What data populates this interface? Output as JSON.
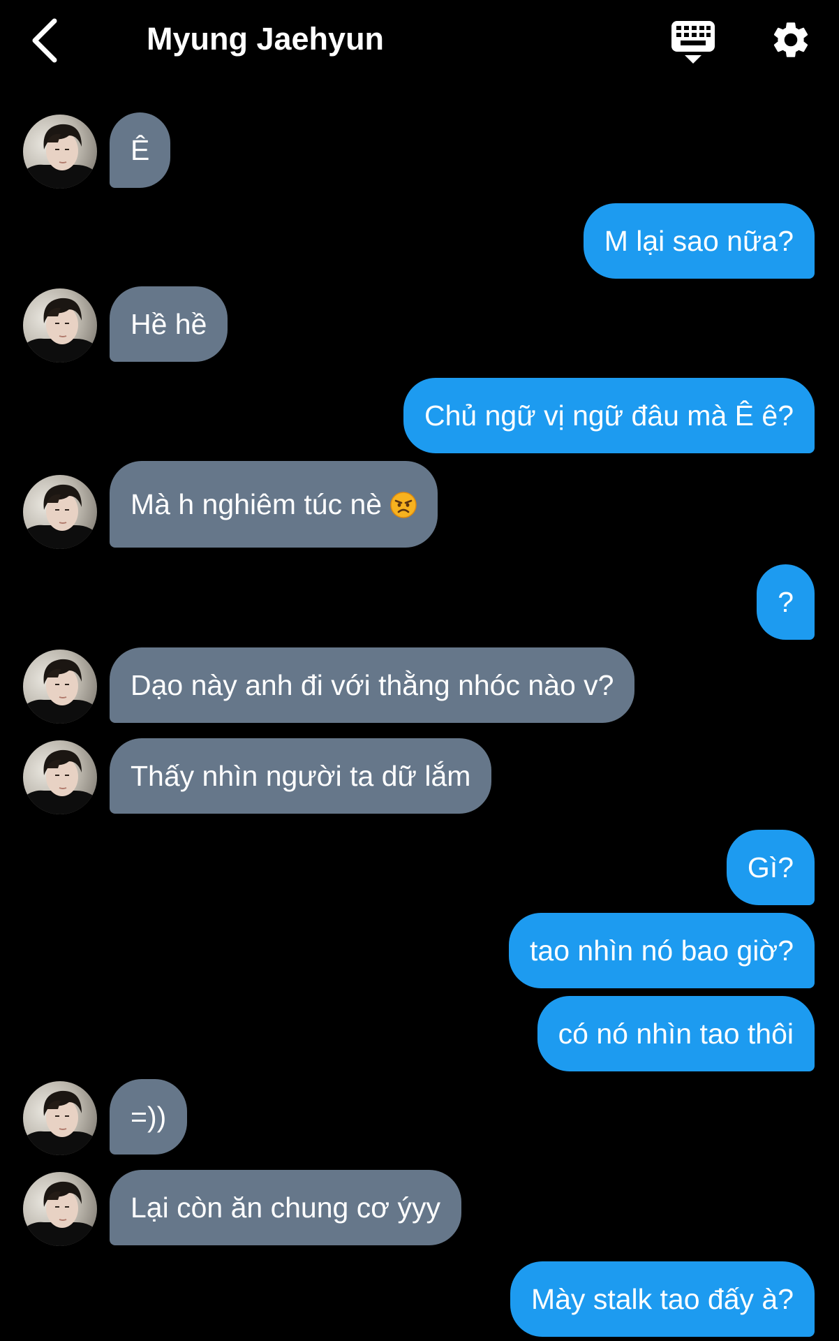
{
  "header": {
    "title": "Myung Jaehyun",
    "back_icon": "chevron-left-icon",
    "keyboard_icon": "keyboard-icon",
    "settings_icon": "gear-icon"
  },
  "colors": {
    "background": "#000000",
    "incoming_bubble": "#66778a",
    "outgoing_bubble": "#1d9bf0",
    "text": "#ffffff"
  },
  "messages": [
    {
      "from": "them",
      "text": "Ê"
    },
    {
      "from": "me",
      "text": "M lại sao nữa?"
    },
    {
      "from": "them",
      "text": "Hề hề"
    },
    {
      "from": "me",
      "text": "Chủ ngữ vị ngữ đâu mà Ê ê?"
    },
    {
      "from": "them",
      "text": "Mà h nghiêm túc nè",
      "emoji": "angry-face-icon"
    },
    {
      "from": "me",
      "text": "?"
    },
    {
      "from": "them",
      "text": "Dạo này anh đi với thằng nhóc nào v?"
    },
    {
      "from": "them",
      "text": "Thấy nhìn người ta dữ lắm"
    },
    {
      "from": "me",
      "text": "Gì?"
    },
    {
      "from": "me",
      "text": "tao nhìn nó bao giờ?"
    },
    {
      "from": "me",
      "text": "có nó nhìn tao thôi"
    },
    {
      "from": "them",
      "text": "=))"
    },
    {
      "from": "them",
      "text": "Lại còn ăn chung cơ ýyy"
    },
    {
      "from": "me",
      "text": "Mày stalk tao đấy à?"
    }
  ]
}
